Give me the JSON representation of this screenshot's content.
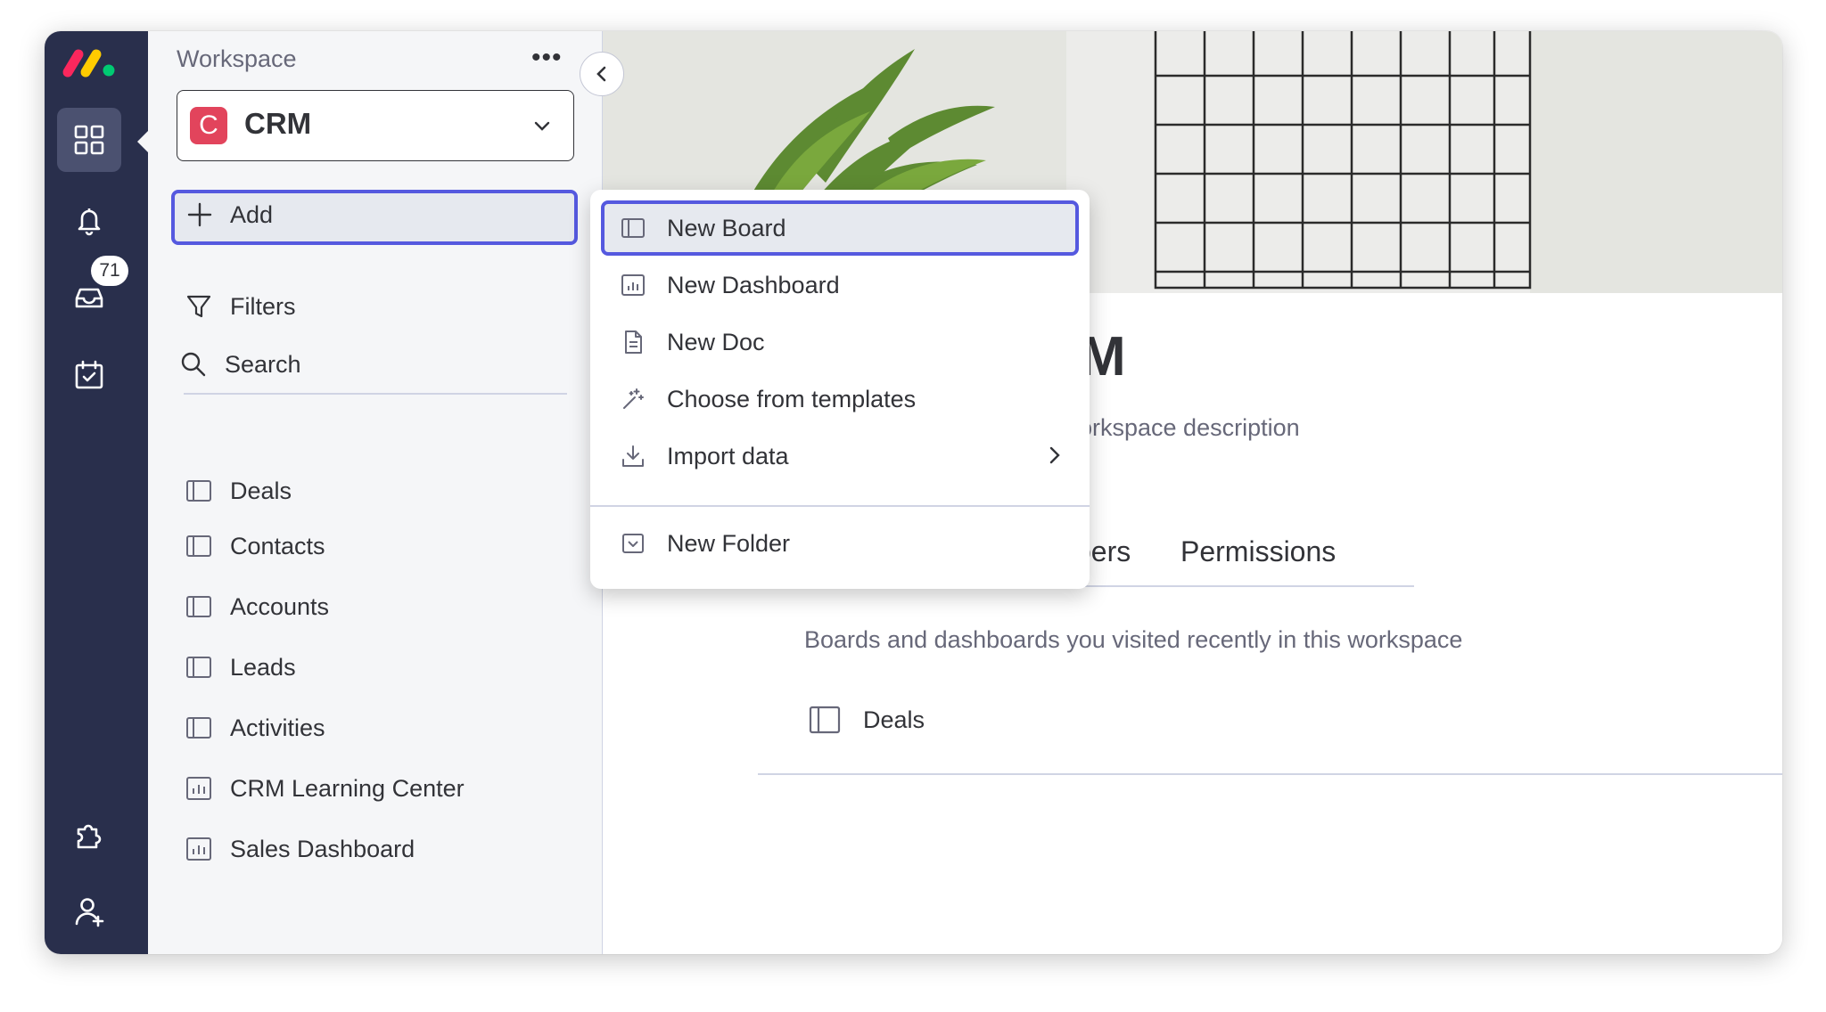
{
  "rail": {
    "inbox_badge": "71",
    "icons": [
      "workspaces-icon",
      "bell-icon",
      "inbox-icon",
      "calendar-check-icon",
      "puzzle-icon",
      "add-user-icon"
    ]
  },
  "workspace": {
    "label": "Workspace",
    "more": "•••",
    "avatar_letter": "C",
    "name": "CRM"
  },
  "nav": {
    "add": "Add",
    "filters": "Filters",
    "search": "Search"
  },
  "boards": [
    {
      "label": "Deals",
      "icon": "board-icon"
    },
    {
      "label": "Contacts",
      "icon": "board-icon"
    },
    {
      "label": "Accounts",
      "icon": "board-icon"
    },
    {
      "label": "Leads",
      "icon": "board-icon"
    },
    {
      "label": "Activities",
      "icon": "board-icon"
    },
    {
      "label": "CRM Learning Center",
      "icon": "dashboard-icon"
    },
    {
      "label": "Sales Dashboard",
      "icon": "dashboard-icon"
    }
  ],
  "menu": {
    "items": [
      {
        "label": "New Board",
        "icon": "board-icon"
      },
      {
        "label": "New Dashboard",
        "icon": "dashboard-icon"
      },
      {
        "label": "New Doc",
        "icon": "doc-icon"
      },
      {
        "label": "Choose from templates",
        "icon": "magic-wand-icon"
      },
      {
        "label": "Import data",
        "icon": "download-icon"
      }
    ],
    "folder": {
      "label": "New Folder",
      "icon": "folder-icon"
    }
  },
  "main": {
    "title_visible": "M",
    "desc_visible": "orkspace description",
    "tabs": [
      "bers",
      "Permissions"
    ],
    "recent_desc": "Boards and dashboards you visited recently in this workspace",
    "recent_items": [
      {
        "label": "Deals"
      }
    ]
  },
  "colors": {
    "rail_bg": "#292f4c",
    "accent": "#5559df",
    "avatar": "#e2445c",
    "panel_bg": "#f5f6f8"
  }
}
